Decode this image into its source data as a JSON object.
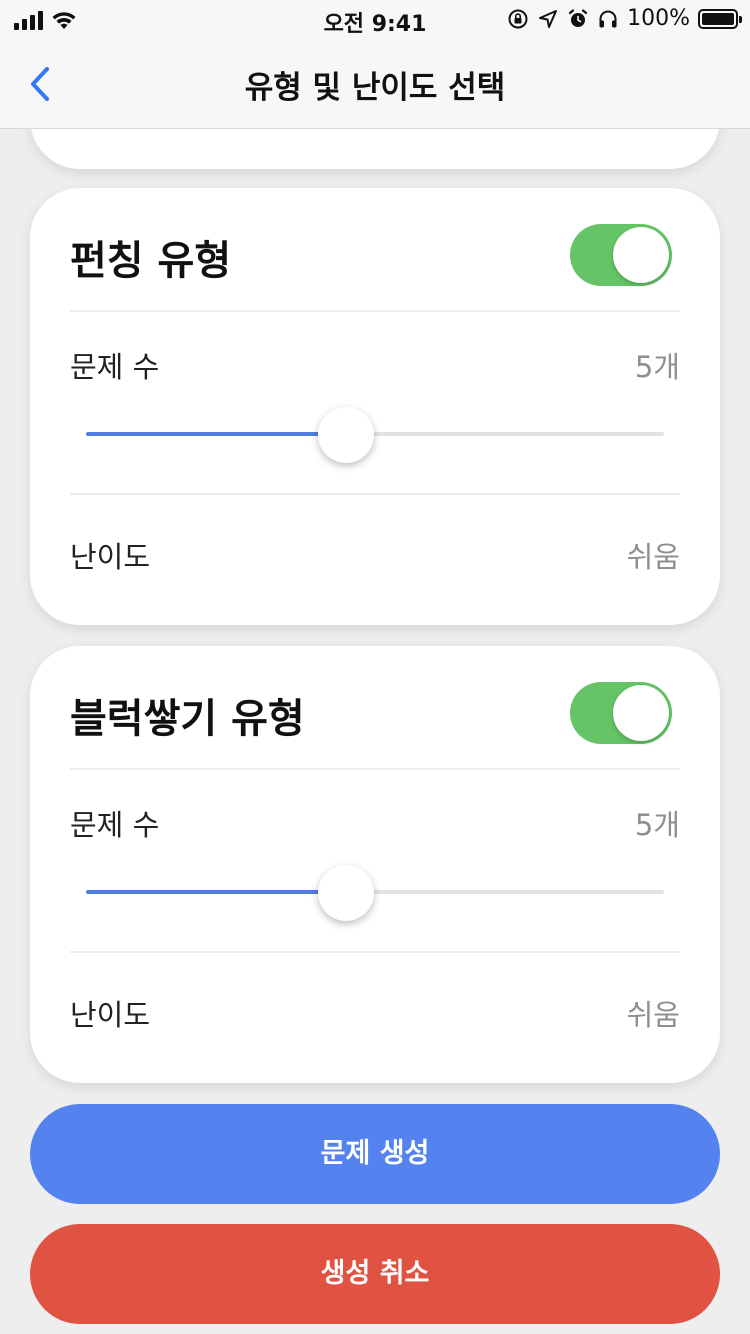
{
  "status_bar": {
    "time": "오전 9:41",
    "battery": "100%"
  },
  "nav": {
    "title": "유형 및 난이도 선택"
  },
  "cards": [
    {
      "title": "펀칭 유형",
      "enabled": true,
      "count_label": "문제 수",
      "count_value": "5개",
      "slider_fraction": 0.45,
      "difficulty_label": "난이도",
      "difficulty_value": "쉬움"
    },
    {
      "title": "블럭쌓기 유형",
      "enabled": true,
      "count_label": "문제 수",
      "count_value": "5개",
      "slider_fraction": 0.45,
      "difficulty_label": "난이도",
      "difficulty_value": "쉬움"
    }
  ],
  "buttons": {
    "generate": "문제 생성",
    "cancel": "생성 취소"
  },
  "colors": {
    "accent": "#4f7de0",
    "toggle_on": "#65c466",
    "generate_button": "#5483ef",
    "cancel_button": "#e05242",
    "back_chevron": "#3478f6"
  },
  "icons": {
    "back": "chevron-left-icon",
    "signal": "cellular-signal-icon",
    "wifi": "wifi-icon",
    "orientation_lock": "orientation-lock-icon",
    "location": "location-arrow-icon",
    "alarm": "alarm-clock-icon",
    "headphones": "headphones-icon",
    "battery": "battery-icon"
  }
}
